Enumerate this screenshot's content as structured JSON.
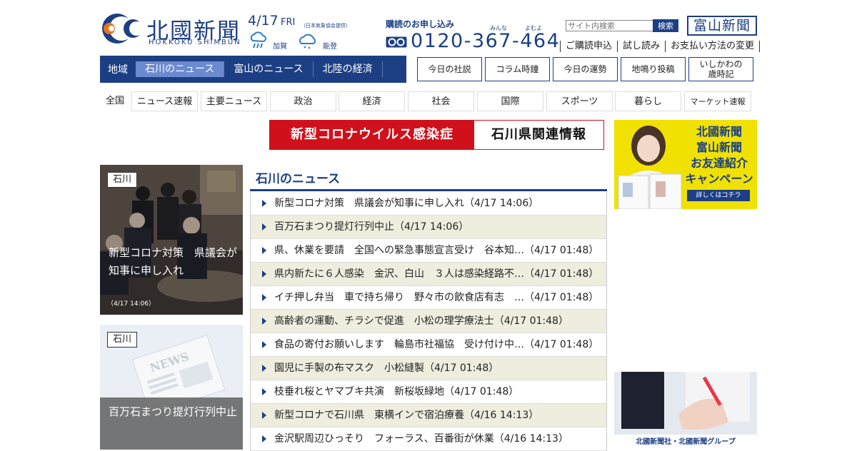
{
  "header": {
    "logo_title": "北國新聞",
    "logo_sub": "HOKKOKU SHIMBUN",
    "date": "4/17",
    "weekday": "FRI",
    "weather_note": "（日本気象協会提供）",
    "weather": [
      {
        "area": "加賀",
        "icon": "rain-cloud-icon"
      },
      {
        "area": "能登",
        "icon": "drizzle-cloud-icon"
      }
    ],
    "subscribe_title": "購読のお申し込み",
    "ruby_minna": "みんな",
    "ruby_yomu": "よむよ",
    "phone": "0120-367-464",
    "search_placeholder": "サイト内検索",
    "search_button": "検索",
    "partner_logo": "富山新聞",
    "sub_links": [
      "ご購読申込",
      "試し読み",
      "お支払い方法の変更"
    ]
  },
  "region_nav": {
    "label": "地域",
    "tabs": [
      "石川のニュース",
      "富山のニュース",
      "北陸の経済"
    ]
  },
  "feature_buttons": [
    "今日の社説",
    "コラム時鐘",
    "今日の運勢",
    "地鳴り投稿",
    "いしかわの",
    "歳時記"
  ],
  "category_nav": {
    "label": "全国",
    "items": [
      "ニュース速報",
      "主要ニュース",
      "政治",
      "経済",
      "社会",
      "国際",
      "スポーツ",
      "暮らし",
      "マーケット速報"
    ]
  },
  "corona_banner": {
    "left": "新型コロナウイルス感染症",
    "right": "石川県関連情報"
  },
  "cards": [
    {
      "tag": "石川",
      "title": "新型コロナ対策　県議会が知事に申し入れ",
      "time": "（4/17 14:06）"
    },
    {
      "tag": "石川",
      "title": "百万石まつり提灯行列中止",
      "time": ""
    }
  ],
  "news": {
    "heading": "石川のニュース",
    "items": [
      "新型コロナ対策　県議会が知事に申し入れ（4/17 14:06）",
      "百万石まつり提灯行列中止（4/17 14:06）",
      "県、休業を要請　全国への緊急事態宣言受け　谷本知…（4/17 01:48）",
      "県内新たに６人感染　金沢、白山　３人は感染経路不…（4/17 01:48）",
      "イチ押し弁当　車で持ち帰り　野々市の飲食店有志　…（4/17 01:48）",
      "高齢者の運動、チラシで促進　小松の理学療法士（4/17 01:48）",
      "食品の寄付お願いします　輪島市社福協　受け付け中…（4/17 01:48）",
      "園児に手製の布マスク　小松縫製（4/17 01:48）",
      "枝垂れ桜とヤマブキ共演　新桜坂緑地（4/17 01:48）",
      "新型コロナで石川県　東横インで宿泊療養（4/16 14:13）",
      "金沢駅周辺ひっそり　フォーラス、百番街が休業（4/16 14:13）"
    ]
  },
  "ads": {
    "ad1_lines": [
      "北國新聞",
      "富山新聞",
      "お友達紹介",
      "キャンペーン"
    ],
    "ad1_button": "詳しくはコチラ",
    "ad2_caption": "北國新聞社・北國新聞グループ",
    "ad1_bg": "#f0e100"
  },
  "colors": {
    "brand": "#1c3f84",
    "corona": "#d0111b",
    "row_alt": "#eeedde"
  }
}
